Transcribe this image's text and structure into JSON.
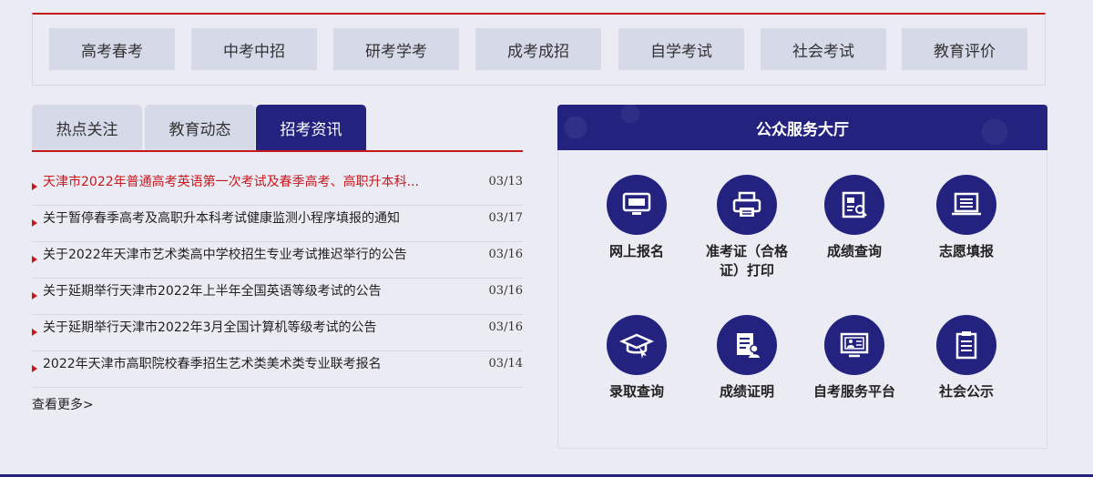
{
  "categories": [
    "高考春考",
    "中考中招",
    "研考学考",
    "成考成招",
    "自学考试",
    "社会考试",
    "教育评价"
  ],
  "tabs": [
    "热点关注",
    "教育动态",
    "招考资讯"
  ],
  "news": [
    {
      "title": "天津市2022年普通高考英语第一次考试及春季高考、高职升本科...",
      "date": "03/13"
    },
    {
      "title": "关于暂停春季高考及高职升本科考试健康监测小程序填报的通知",
      "date": "03/17"
    },
    {
      "title": "关于2022年天津市艺术类高中学校招生专业考试推迟举行的公告",
      "date": "03/16"
    },
    {
      "title": "关于延期举行天津市2022年上半年全国英语等级考试的公告",
      "date": "03/16"
    },
    {
      "title": "关于延期举行天津市2022年3月全国计算机等级考试的公告",
      "date": "03/16"
    },
    {
      "title": "2022年天津市高职院校春季招生艺术类美术类专业联考报名",
      "date": "03/14"
    }
  ],
  "more": "查看更多>",
  "service": {
    "title": "公众服务大厅",
    "items": [
      {
        "label": "网上报名",
        "icon": "monitor-icon"
      },
      {
        "label": "准考证（合格证）打印",
        "icon": "printer-icon"
      },
      {
        "label": "成绩查询",
        "icon": "score-search-icon"
      },
      {
        "label": "志愿填报",
        "icon": "laptop-list-icon"
      },
      {
        "label": "录取查询",
        "icon": "graduation-cap-icon"
      },
      {
        "label": "成绩证明",
        "icon": "certificate-icon"
      },
      {
        "label": "自考服务平台",
        "icon": "online-platform-icon"
      },
      {
        "label": "社会公示",
        "icon": "clipboard-icon"
      }
    ]
  },
  "colors": {
    "primary": "#23237f",
    "accent": "#c8161d",
    "button_bg": "#d5d9e8",
    "page_bg": "#ebebf3"
  }
}
